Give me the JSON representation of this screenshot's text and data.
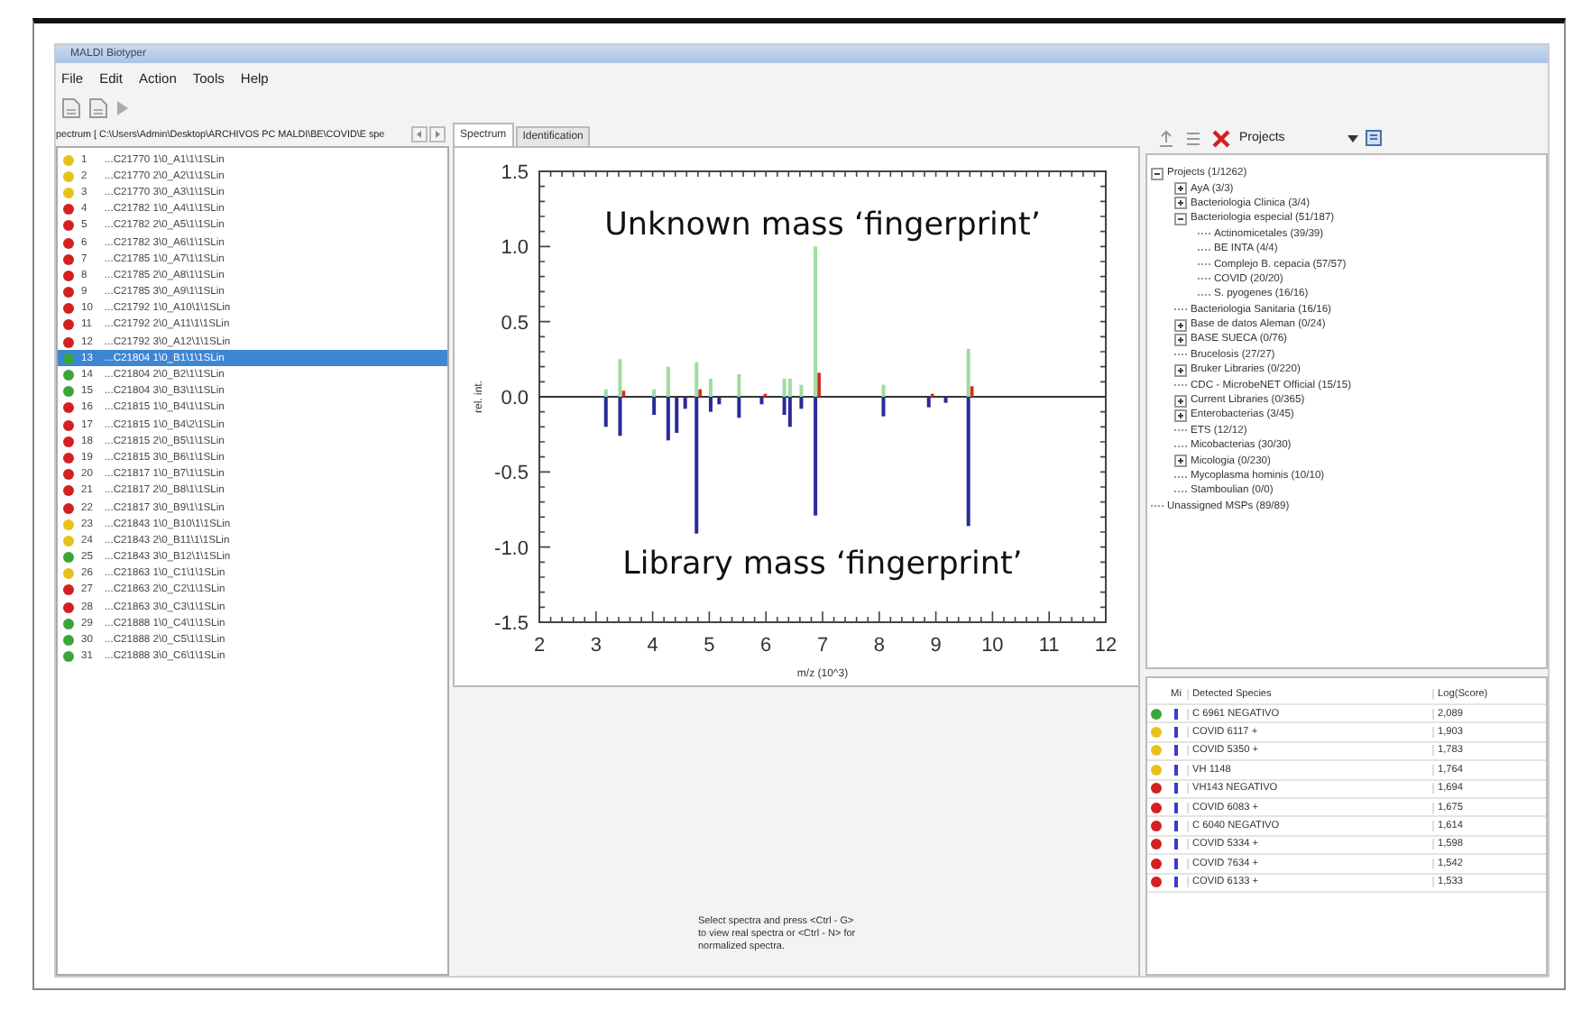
{
  "window": {
    "title": "MALDI Biotyper"
  },
  "menu": [
    "File",
    "Edit",
    "Action",
    "Tools",
    "Help"
  ],
  "spectra_panel": {
    "path": "pectrum [ C:\\Users\\Admin\\Desktop\\ARCHIVOS PC MALDI\\BE\\COVID\\E spe",
    "items": [
      {
        "number": "1",
        "name": "...C21770 1\\0_A1\\1\\1SLin",
        "color": "#e8c21a",
        "selected": false
      },
      {
        "number": "2",
        "name": "...C21770 2\\0_A2\\1\\1SLin",
        "color": "#e8c21a",
        "selected": false
      },
      {
        "number": "3",
        "name": "...C21770 3\\0_A3\\1\\1SLin",
        "color": "#e8c21a",
        "selected": false
      },
      {
        "number": "4",
        "name": "...C21782 1\\0_A4\\1\\1SLin",
        "color": "#d42020",
        "selected": false
      },
      {
        "number": "5",
        "name": "...C21782 2\\0_A5\\1\\1SLin",
        "color": "#d42020",
        "selected": false
      },
      {
        "number": "6",
        "name": "...C21782 3\\0_A6\\1\\1SLin",
        "color": "#d42020",
        "selected": false
      },
      {
        "number": "7",
        "name": "...C21785 1\\0_A7\\1\\1SLin",
        "color": "#d42020",
        "selected": false
      },
      {
        "number": "8",
        "name": "...C21785 2\\0_A8\\1\\1SLin",
        "color": "#d42020",
        "selected": false
      },
      {
        "number": "9",
        "name": "...C21785 3\\0_A9\\1\\1SLin",
        "color": "#d42020",
        "selected": false
      },
      {
        "number": "10",
        "name": "...C21792 1\\0_A10\\1\\1SLin",
        "color": "#d42020",
        "selected": false
      },
      {
        "number": "11",
        "name": "...C21792 2\\0_A11\\1\\1SLin",
        "color": "#d42020",
        "selected": false
      },
      {
        "number": "12",
        "name": "...C21792 3\\0_A12\\1\\1SLin",
        "color": "#d42020",
        "selected": false
      },
      {
        "number": "13",
        "name": "...C21804 1\\0_B1\\1\\1SLin",
        "color": "#3aa63a",
        "selected": true
      },
      {
        "number": "14",
        "name": "...C21804 2\\0_B2\\1\\1SLin",
        "color": "#3aa63a",
        "selected": false
      },
      {
        "number": "15",
        "name": "...C21804 3\\0_B3\\1\\1SLin",
        "color": "#3aa63a",
        "selected": false
      },
      {
        "number": "16",
        "name": "...C21815 1\\0_B4\\1\\1SLin",
        "color": "#d42020",
        "selected": false
      },
      {
        "number": "17",
        "name": "...C21815 1\\0_B4\\2\\1SLin",
        "color": "#d42020",
        "selected": false
      },
      {
        "number": "18",
        "name": "...C21815 2\\0_B5\\1\\1SLin",
        "color": "#d42020",
        "selected": false
      },
      {
        "number": "19",
        "name": "...C21815 3\\0_B6\\1\\1SLin",
        "color": "#d42020",
        "selected": false
      },
      {
        "number": "20",
        "name": "...C21817 1\\0_B7\\1\\1SLin",
        "color": "#d42020",
        "selected": false
      },
      {
        "number": "21",
        "name": "...C21817 2\\0_B8\\1\\1SLin",
        "color": "#d42020",
        "selected": false
      },
      {
        "number": "22",
        "name": "...C21817 3\\0_B9\\1\\1SLin",
        "color": "#d42020",
        "selected": false
      },
      {
        "number": "23",
        "name": "...C21843 1\\0_B10\\1\\1SLin",
        "color": "#e8c21a",
        "selected": false
      },
      {
        "number": "24",
        "name": "...C21843 2\\0_B11\\1\\1SLin",
        "color": "#e8c21a",
        "selected": false
      },
      {
        "number": "25",
        "name": "...C21843 3\\0_B12\\1\\1SLin",
        "color": "#3aa63a",
        "selected": false
      },
      {
        "number": "26",
        "name": "...C21863 1\\0_C1\\1\\1SLin",
        "color": "#e8c21a",
        "selected": false
      },
      {
        "number": "27",
        "name": "...C21863 2\\0_C2\\1\\1SLin",
        "color": "#d42020",
        "selected": false
      },
      {
        "number": "28",
        "name": "...C21863 3\\0_C3\\1\\1SLin",
        "color": "#d42020",
        "selected": false
      },
      {
        "number": "29",
        "name": "...C21888 1\\0_C4\\1\\1SLin",
        "color": "#3aa63a",
        "selected": false
      },
      {
        "number": "30",
        "name": "...C21888 2\\0_C5\\1\\1SLin",
        "color": "#3aa63a",
        "selected": false
      },
      {
        "number": "31",
        "name": "...C21888 3\\0_C6\\1\\1SLin",
        "color": "#3aa63a",
        "selected": false
      }
    ]
  },
  "tabs": [
    {
      "label": "Spectrum",
      "selected": true
    },
    {
      "label": "Identification",
      "selected": false
    }
  ],
  "spectrum": {
    "chart_data": {
      "type": "bar",
      "xlabel": "m/z (10^3)",
      "ylabel": "rel. int.",
      "x": [
        3.2,
        3.45,
        4.05,
        4.3,
        4.45,
        4.6,
        4.8,
        5.05,
        5.2,
        5.55,
        5.95,
        6.35,
        6.45,
        6.65,
        6.9,
        8.1,
        8.9,
        9.2,
        9.6
      ],
      "series": [
        {
          "color": "#9fdc9f",
          "values": [
            0.05,
            0.25,
            0.05,
            0.2,
            null,
            null,
            0.23,
            0.12,
            null,
            0.15,
            null,
            0.12,
            0.12,
            0.08,
            1.0,
            0.08,
            null,
            null,
            0.32
          ]
        },
        {
          "color": "#d42a1a",
          "values": [
            null,
            0.04,
            null,
            null,
            null,
            null,
            0.05,
            null,
            null,
            null,
            0.02,
            null,
            null,
            null,
            0.16,
            null,
            0.02,
            null,
            0.07
          ]
        },
        {
          "color": "#2a2a9a",
          "values": [
            -0.2,
            -0.26,
            -0.12,
            -0.29,
            -0.24,
            -0.08,
            -0.91,
            -0.1,
            -0.05,
            -0.14,
            -0.05,
            -0.12,
            -0.2,
            -0.08,
            -0.79,
            -0.13,
            -0.07,
            -0.04,
            -0.86
          ]
        }
      ],
      "xlim": [
        2,
        12
      ],
      "ylim": [
        -1.5,
        1.5
      ],
      "xticks": [
        2,
        3,
        4,
        5,
        6,
        7,
        8,
        9,
        10,
        11,
        12
      ],
      "yticks": [
        {
          "value": 1.5,
          "label": "1.5"
        },
        {
          "value": 1,
          "label": "1.0"
        },
        {
          "value": 0.5,
          "label": "0.5"
        },
        {
          "value": 0,
          "label": "0.0"
        },
        {
          "value": -0.5,
          "label": "-0.5"
        },
        {
          "value": -1,
          "label": "-1.0"
        },
        {
          "value": -1.5,
          "label": "-1.5"
        }
      ],
      "annotations": [
        "Unknown mass ‘fingerprint’",
        "Library mass ‘fingerprint’"
      ]
    },
    "hint": "Select spectra and press <Ctrl - G> to view real spectra or <Ctrl - N> for normalized spectra."
  },
  "projects": {
    "dropdown": "Projects",
    "nodes": [
      {
        "label": "Projects (1/1262)",
        "expanded": true,
        "children": [
          {
            "label": "AyA (3/3)",
            "expanded": false
          },
          {
            "label": "Bacteriologia Clinica (3/4)",
            "expanded": false
          },
          {
            "label": "Bacteriologia especial (51/187)",
            "expanded": true,
            "children": [
              {
                "label": "Actinomicetales (39/39)"
              },
              {
                "label": "BE INTA (4/4)"
              },
              {
                "label": "Complejo B. cepacia (57/57)"
              },
              {
                "label": "COVID (20/20)"
              },
              {
                "label": "S. pyogenes (16/16)"
              }
            ]
          },
          {
            "label": "Bacteriologia Sanitaria (16/16)"
          },
          {
            "label": "Base de datos Aleman (0/24)",
            "expanded": false
          },
          {
            "label": "BASE SUECA (0/76)",
            "expanded": false
          },
          {
            "label": "Brucelosis (27/27)"
          },
          {
            "label": "Bruker Libraries (0/220)",
            "expanded": false
          },
          {
            "label": "CDC - MicrobeNET Official (15/15)"
          },
          {
            "label": "Current Libraries (0/365)",
            "expanded": false
          },
          {
            "label": "Enterobacterias (3/45)",
            "expanded": false
          },
          {
            "label": "ETS (12/12)"
          },
          {
            "label": "Micobacterias (30/30)"
          },
          {
            "label": "Micologia (0/230)",
            "expanded": false
          },
          {
            "label": "Mycoplasma hominis (10/10)"
          },
          {
            "label": "Stamboulian (0/0)"
          }
        ]
      },
      {
        "label": "Unassigned MSPs (89/89)"
      }
    ]
  },
  "results": {
    "columns": [
      "Mi",
      "Detected Species",
      "Log(Score)"
    ],
    "rows": [
      {
        "color": "#3aa63a",
        "species": "C 6961 NEGATIVO",
        "score": "2,089"
      },
      {
        "color": "#e8c21a",
        "species": "COVID 6117 +",
        "score": "1,903"
      },
      {
        "color": "#e8c21a",
        "species": "COVID 5350 +",
        "score": "1,783"
      },
      {
        "color": "#e8c21a",
        "species": "VH 1148",
        "score": "1,764"
      },
      {
        "color": "#d42020",
        "species": "VH143 NEGATIVO",
        "score": "1,694"
      },
      {
        "color": "#d42020",
        "species": "COVID 6083 +",
        "score": "1,675"
      },
      {
        "color": "#d42020",
        "species": "C 6040 NEGATIVO",
        "score": "1,614"
      },
      {
        "color": "#d42020",
        "species": "COVID 5334 +",
        "score": "1,598"
      },
      {
        "color": "#d42020",
        "species": "COVID 7634 +",
        "score": "1,542"
      },
      {
        "color": "#d42020",
        "species": "COVID 6133 +",
        "score": "1,533"
      }
    ]
  }
}
